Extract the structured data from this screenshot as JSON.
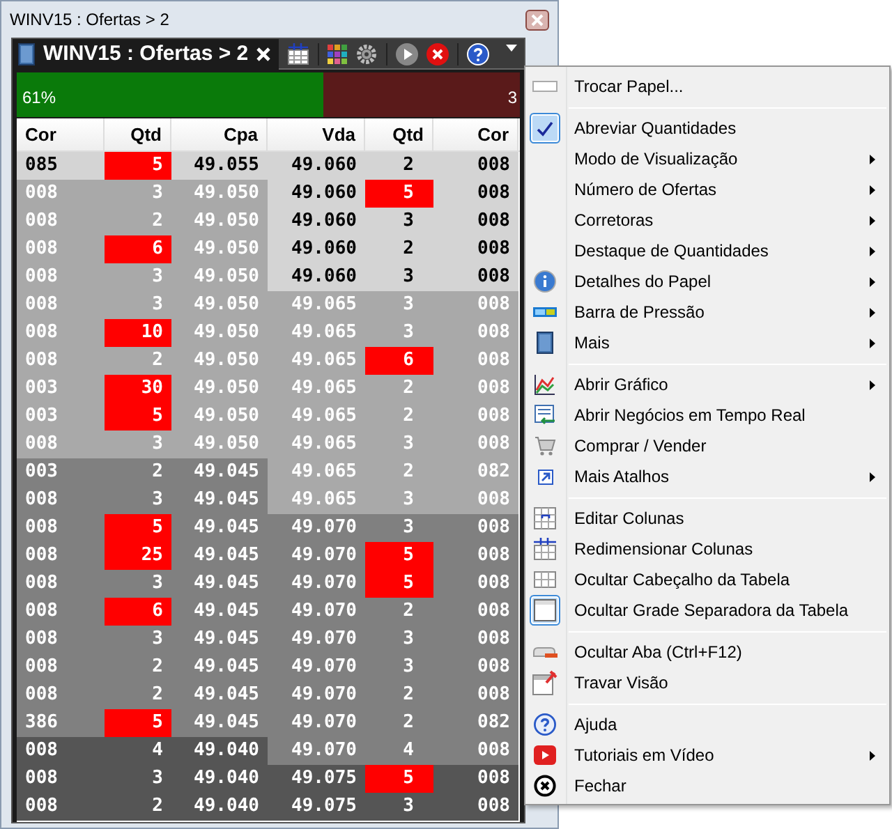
{
  "window": {
    "title": "WINV15 : Ofertas > 2"
  },
  "tab": {
    "label": "WINV15 : Ofertas > 2",
    "selected": true
  },
  "pressure_bar": {
    "level": 0.61,
    "buy_reading": "61%",
    "sell_reading": "3"
  },
  "table": {
    "columns": [
      "Cor",
      "Qtd",
      "Cpa",
      "Vda",
      "Qtd",
      "Cor"
    ],
    "rows": [
      {
        "bid": {
          "broker": "085",
          "qty": "5",
          "highlight": true,
          "price": "49.055",
          "color": "#d4d4d4"
        },
        "ask": {
          "price": "49.060",
          "qty": "2",
          "highlight": false,
          "broker": "008",
          "color": "#d4d4d4"
        }
      },
      {
        "bid": {
          "broker": "008",
          "qty": "3",
          "highlight": false,
          "price": "49.050",
          "color": "#a9a9a9"
        },
        "ask": {
          "price": "49.060",
          "qty": "5",
          "highlight": true,
          "broker": "008",
          "color": "#d4d4d4"
        }
      },
      {
        "bid": {
          "broker": "008",
          "qty": "2",
          "highlight": false,
          "price": "49.050",
          "color": "#a9a9a9"
        },
        "ask": {
          "price": "49.060",
          "qty": "3",
          "highlight": false,
          "broker": "008",
          "color": "#d4d4d4"
        }
      },
      {
        "bid": {
          "broker": "008",
          "qty": "6",
          "highlight": true,
          "price": "49.050",
          "color": "#a9a9a9"
        },
        "ask": {
          "price": "49.060",
          "qty": "2",
          "highlight": false,
          "broker": "008",
          "color": "#d4d4d4"
        }
      },
      {
        "bid": {
          "broker": "008",
          "qty": "3",
          "highlight": false,
          "price": "49.050",
          "color": "#a9a9a9"
        },
        "ask": {
          "price": "49.060",
          "qty": "3",
          "highlight": false,
          "broker": "008",
          "color": "#d4d4d4"
        }
      },
      {
        "bid": {
          "broker": "008",
          "qty": "3",
          "highlight": false,
          "price": "49.050",
          "color": "#a9a9a9"
        },
        "ask": {
          "price": "49.065",
          "qty": "3",
          "highlight": false,
          "broker": "008",
          "color": "#a9a9a9"
        }
      },
      {
        "bid": {
          "broker": "008",
          "qty": "10",
          "highlight": true,
          "price": "49.050",
          "color": "#a9a9a9"
        },
        "ask": {
          "price": "49.065",
          "qty": "3",
          "highlight": false,
          "broker": "008",
          "color": "#a9a9a9"
        }
      },
      {
        "bid": {
          "broker": "008",
          "qty": "2",
          "highlight": false,
          "price": "49.050",
          "color": "#a9a9a9"
        },
        "ask": {
          "price": "49.065",
          "qty": "6",
          "highlight": true,
          "broker": "008",
          "color": "#a9a9a9"
        }
      },
      {
        "bid": {
          "broker": "003",
          "qty": "30",
          "highlight": true,
          "price": "49.050",
          "color": "#a9a9a9"
        },
        "ask": {
          "price": "49.065",
          "qty": "2",
          "highlight": false,
          "broker": "008",
          "color": "#a9a9a9"
        }
      },
      {
        "bid": {
          "broker": "003",
          "qty": "5",
          "highlight": true,
          "price": "49.050",
          "color": "#a9a9a9"
        },
        "ask": {
          "price": "49.065",
          "qty": "2",
          "highlight": false,
          "broker": "008",
          "color": "#a9a9a9"
        }
      },
      {
        "bid": {
          "broker": "008",
          "qty": "3",
          "highlight": false,
          "price": "49.050",
          "color": "#a9a9a9"
        },
        "ask": {
          "price": "49.065",
          "qty": "3",
          "highlight": false,
          "broker": "008",
          "color": "#a9a9a9"
        }
      },
      {
        "bid": {
          "broker": "003",
          "qty": "2",
          "highlight": false,
          "price": "49.045",
          "color": "#808080"
        },
        "ask": {
          "price": "49.065",
          "qty": "2",
          "highlight": false,
          "broker": "082",
          "color": "#a9a9a9"
        }
      },
      {
        "bid": {
          "broker": "008",
          "qty": "3",
          "highlight": false,
          "price": "49.045",
          "color": "#808080"
        },
        "ask": {
          "price": "49.065",
          "qty": "3",
          "highlight": false,
          "broker": "008",
          "color": "#a9a9a9"
        }
      },
      {
        "bid": {
          "broker": "008",
          "qty": "5",
          "highlight": true,
          "price": "49.045",
          "color": "#808080"
        },
        "ask": {
          "price": "49.070",
          "qty": "3",
          "highlight": false,
          "broker": "008",
          "color": "#808080"
        }
      },
      {
        "bid": {
          "broker": "008",
          "qty": "25",
          "highlight": true,
          "price": "49.045",
          "color": "#808080"
        },
        "ask": {
          "price": "49.070",
          "qty": "5",
          "highlight": true,
          "broker": "008",
          "color": "#808080"
        }
      },
      {
        "bid": {
          "broker": "008",
          "qty": "3",
          "highlight": false,
          "price": "49.045",
          "color": "#808080"
        },
        "ask": {
          "price": "49.070",
          "qty": "5",
          "highlight": true,
          "broker": "008",
          "color": "#808080"
        }
      },
      {
        "bid": {
          "broker": "008",
          "qty": "6",
          "highlight": true,
          "price": "49.045",
          "color": "#808080"
        },
        "ask": {
          "price": "49.070",
          "qty": "2",
          "highlight": false,
          "broker": "008",
          "color": "#808080"
        }
      },
      {
        "bid": {
          "broker": "008",
          "qty": "3",
          "highlight": false,
          "price": "49.045",
          "color": "#808080"
        },
        "ask": {
          "price": "49.070",
          "qty": "3",
          "highlight": false,
          "broker": "008",
          "color": "#808080"
        }
      },
      {
        "bid": {
          "broker": "008",
          "qty": "2",
          "highlight": false,
          "price": "49.045",
          "color": "#808080"
        },
        "ask": {
          "price": "49.070",
          "qty": "3",
          "highlight": false,
          "broker": "008",
          "color": "#808080"
        }
      },
      {
        "bid": {
          "broker": "008",
          "qty": "2",
          "highlight": false,
          "price": "49.045",
          "color": "#808080"
        },
        "ask": {
          "price": "49.070",
          "qty": "2",
          "highlight": false,
          "broker": "008",
          "color": "#808080"
        }
      },
      {
        "bid": {
          "broker": "386",
          "qty": "5",
          "highlight": true,
          "price": "49.045",
          "color": "#808080"
        },
        "ask": {
          "price": "49.070",
          "qty": "2",
          "highlight": false,
          "broker": "082",
          "color": "#808080"
        }
      },
      {
        "bid": {
          "broker": "008",
          "qty": "4",
          "highlight": false,
          "price": "49.040",
          "color": "#555555"
        },
        "ask": {
          "price": "49.070",
          "qty": "4",
          "highlight": false,
          "broker": "008",
          "color": "#808080"
        }
      },
      {
        "bid": {
          "broker": "008",
          "qty": "3",
          "highlight": false,
          "price": "49.040",
          "color": "#555555"
        },
        "ask": {
          "price": "49.075",
          "qty": "5",
          "highlight": true,
          "broker": "008",
          "color": "#555555"
        }
      },
      {
        "bid": {
          "broker": "008",
          "qty": "2",
          "highlight": false,
          "price": "49.040",
          "color": "#555555"
        },
        "ask": {
          "price": "49.075",
          "qty": "3",
          "highlight": false,
          "broker": "008",
          "color": "#555555"
        }
      }
    ]
  },
  "context_menu": {
    "items": [
      {
        "kind": "item",
        "label": "Trocar Papel...",
        "checked": false,
        "submenu": false
      },
      {
        "kind": "separator"
      },
      {
        "kind": "item",
        "label": "Abreviar Quantidades",
        "checked": true,
        "submenu": false
      },
      {
        "kind": "item",
        "label": "Modo de Visualização",
        "checked": false,
        "submenu": true
      },
      {
        "kind": "item",
        "label": "Número de Ofertas",
        "checked": false,
        "submenu": true
      },
      {
        "kind": "item",
        "label": "Corretoras",
        "checked": false,
        "submenu": true
      },
      {
        "kind": "item",
        "label": "Destaque de Quantidades",
        "checked": false,
        "submenu": true
      },
      {
        "kind": "item",
        "label": "Detalhes do Papel",
        "checked": false,
        "submenu": true
      },
      {
        "kind": "item",
        "label": "Barra de Pressão",
        "checked": false,
        "submenu": true
      },
      {
        "kind": "item",
        "label": "Mais",
        "checked": false,
        "submenu": true
      },
      {
        "kind": "separator"
      },
      {
        "kind": "item",
        "label": "Abrir Gráfico",
        "checked": false,
        "submenu": true
      },
      {
        "kind": "item",
        "label": "Abrir Negócios em Tempo Real",
        "checked": false,
        "submenu": false
      },
      {
        "kind": "item",
        "label": "Comprar / Vender",
        "checked": false,
        "submenu": false
      },
      {
        "kind": "item",
        "label": "Mais Atalhos",
        "checked": false,
        "submenu": true
      },
      {
        "kind": "separator"
      },
      {
        "kind": "item",
        "label": "Editar Colunas",
        "checked": false,
        "submenu": false
      },
      {
        "kind": "item",
        "label": "Redimensionar Colunas",
        "checked": false,
        "submenu": false
      },
      {
        "kind": "item",
        "label": "Ocultar Cabeçalho da Tabela",
        "checked": false,
        "submenu": false
      },
      {
        "kind": "item",
        "label": "Ocultar Grade Separadora da Tabela",
        "checked": true,
        "submenu": false
      },
      {
        "kind": "separator"
      },
      {
        "kind": "item",
        "label": "Ocultar Aba (Ctrl+F12)",
        "checked": false,
        "submenu": false
      },
      {
        "kind": "item",
        "label": "Travar Visão",
        "checked": false,
        "submenu": false
      },
      {
        "kind": "separator"
      },
      {
        "kind": "item",
        "label": "Ajuda",
        "checked": false,
        "submenu": false
      },
      {
        "kind": "item",
        "label": "Tutoriais em Vídeo",
        "checked": false,
        "submenu": true
      },
      {
        "kind": "item",
        "label": "Fechar",
        "checked": false,
        "submenu": false
      }
    ]
  }
}
